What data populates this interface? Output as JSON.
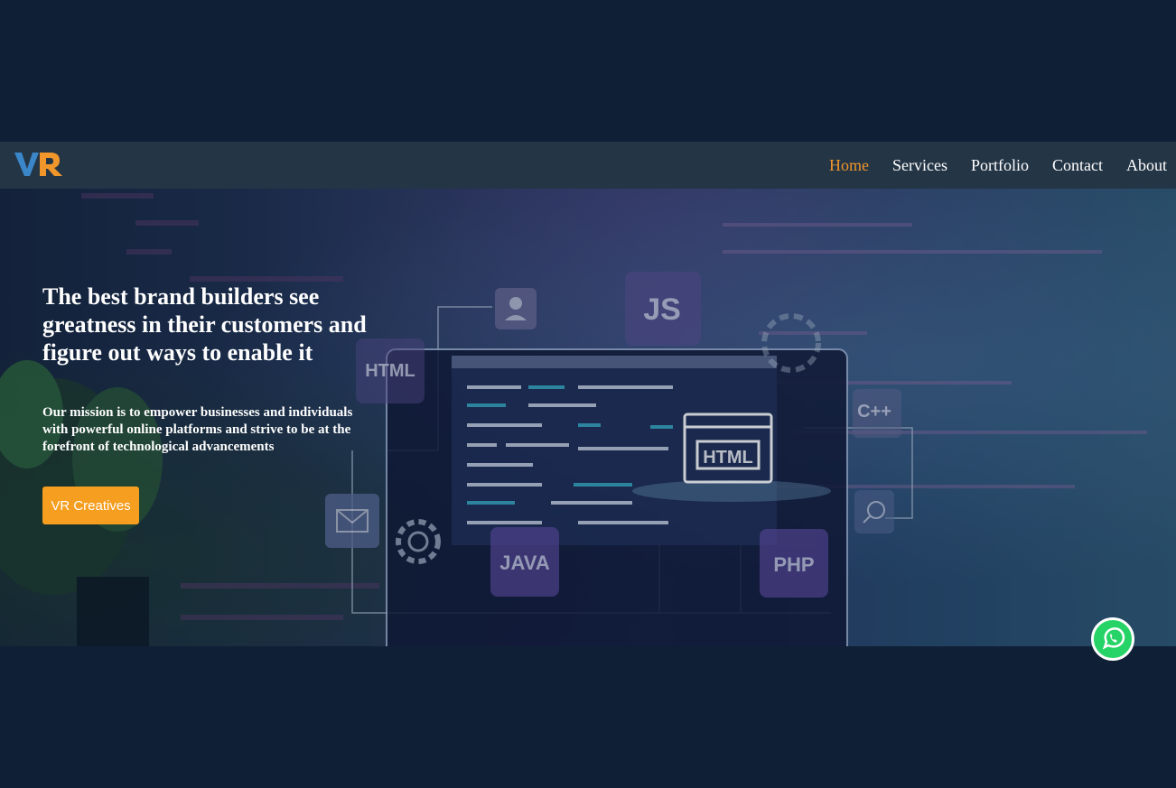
{
  "brand": {
    "logo_text": "VR",
    "logo_colors": [
      "#3a86c8",
      "#f0962a"
    ]
  },
  "nav": {
    "items": [
      {
        "label": "Home",
        "active": true
      },
      {
        "label": "Services",
        "active": false
      },
      {
        "label": "Portfolio",
        "active": false
      },
      {
        "label": "Contact",
        "active": false
      },
      {
        "label": "About",
        "active": false
      }
    ]
  },
  "hero": {
    "heading": "The best brand builders see greatness in their customers and figure out ways to enable it",
    "subheading": "Our mission is to empower businesses and individuals with powerful online platforms and strive to be at the forefront of technological advancements",
    "cta_label": "VR Creatives",
    "background_labels": {
      "html": "HTML",
      "js": "JS",
      "cpp": "C++",
      "java": "JAVA",
      "php": "PHP",
      "html_screen": "HTML"
    }
  },
  "colors": {
    "page_bg": "#0f1f35",
    "navbar_bg": "#243546",
    "accent": "#f0962a",
    "cta_bg": "#f59e1f",
    "whatsapp": "#25d366"
  },
  "floating": {
    "icon": "whatsapp-icon"
  }
}
